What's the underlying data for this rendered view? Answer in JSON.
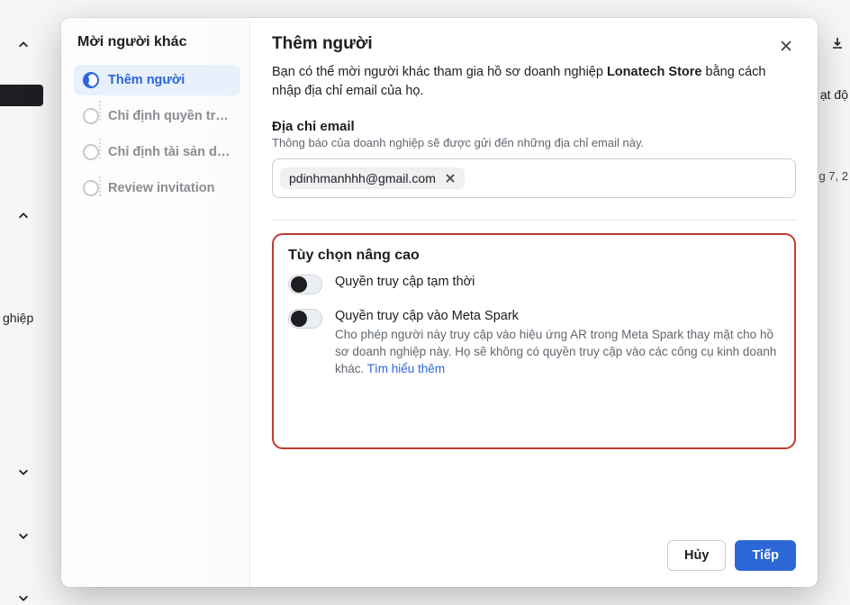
{
  "background": {
    "fragments": {
      "activity": "ạt độ",
      "date": "g 7, 2",
      "biz": "ghiệp"
    }
  },
  "modal": {
    "sidebar": {
      "title": "Mời người khác",
      "steps": [
        {
          "label": "Thêm người"
        },
        {
          "label": "Chỉ định quyền tr…"
        },
        {
          "label": "Chỉ định tài sản d…"
        },
        {
          "label": "Review invitation"
        }
      ]
    },
    "main": {
      "title": "Thêm người",
      "intro_pre": "Bạn có thể mời người khác tham gia hồ sơ doanh nghiệp ",
      "intro_business": "Lonatech Store",
      "intro_post": " bằng cách nhập địa chỉ email của họ.",
      "email_field": {
        "label": "Địa chỉ email",
        "sublabel": "Thông báo của doanh nghiệp sẽ được gửi đến những địa chỉ email này.",
        "chips": [
          {
            "text": "pdinhmanhhh@gmail.com"
          }
        ]
      },
      "advanced": {
        "title": "Tùy chọn nâng cao",
        "toggles": [
          {
            "title": "Quyền truy cập tạm thời",
            "desc": "",
            "link": ""
          },
          {
            "title": "Quyền truy cập vào Meta Spark",
            "desc": "Cho phép người này truy cập vào hiệu ứng AR trong Meta Spark thay mặt cho hồ sơ doanh nghiệp này. Họ sẽ không có quyền truy cập vào các công cụ kinh doanh khác. ",
            "link": "Tìm hiểu thêm"
          }
        ]
      }
    },
    "footer": {
      "cancel": "Hủy",
      "next": "Tiếp"
    }
  }
}
